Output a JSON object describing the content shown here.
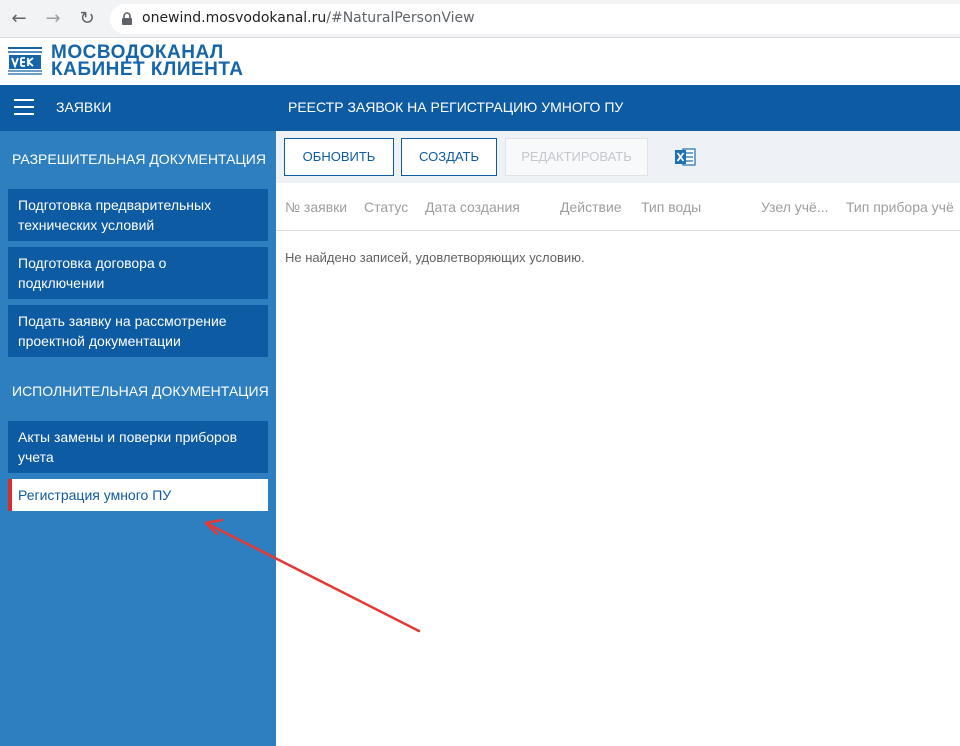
{
  "browser": {
    "url_host": "onewind.mosvodokanal.ru",
    "url_rest": "/#NaturalPersonView"
  },
  "brand": {
    "line1": "МОСВОДОКАНАЛ",
    "line2": "КАБИНЕТ КЛИЕНТА"
  },
  "header": {
    "section_label": "ЗАЯВКИ",
    "page_title": "РЕЕСТР ЗАЯВОК НА РЕГИСТРАЦИЮ УМНОГО ПУ"
  },
  "sidebar": {
    "section1": "РАЗРЕШИТЕЛЬНАЯ ДОКУМЕНТАЦИЯ",
    "section2": "ИСПОЛНИТЕЛЬНАЯ ДОКУМЕНТАЦИЯ",
    "items": [
      {
        "line1": "Подготовка предварительных",
        "line2": "технических условий"
      },
      {
        "line1": "Подготовка договора о",
        "line2": "подключении"
      },
      {
        "line1": "Подать заявку на рассмотрение",
        "line2": "проектной документации"
      },
      {
        "line1": "Акты замены и поверки приборов",
        "line2": "учета"
      },
      {
        "line1": "Регистрация умного ПУ"
      }
    ]
  },
  "toolbar": {
    "refresh_label": "ОБНОВИТЬ",
    "create_label": "СОЗДАТЬ",
    "edit_label": "РЕДАКТИРОВАТЬ"
  },
  "grid": {
    "columns": [
      "№ заявки",
      "Статус",
      "Дата создания",
      "Действие",
      "Тип воды",
      "Узел учё...",
      "Тип прибора учё"
    ],
    "empty_message": "Не найдено записей, удовлетворяющих условию."
  },
  "colors": {
    "primary": "#0d5ba3",
    "sidebar": "#2e7fc0",
    "active_marker": "#d32f2f",
    "annotation_arrow": "#e53935"
  }
}
